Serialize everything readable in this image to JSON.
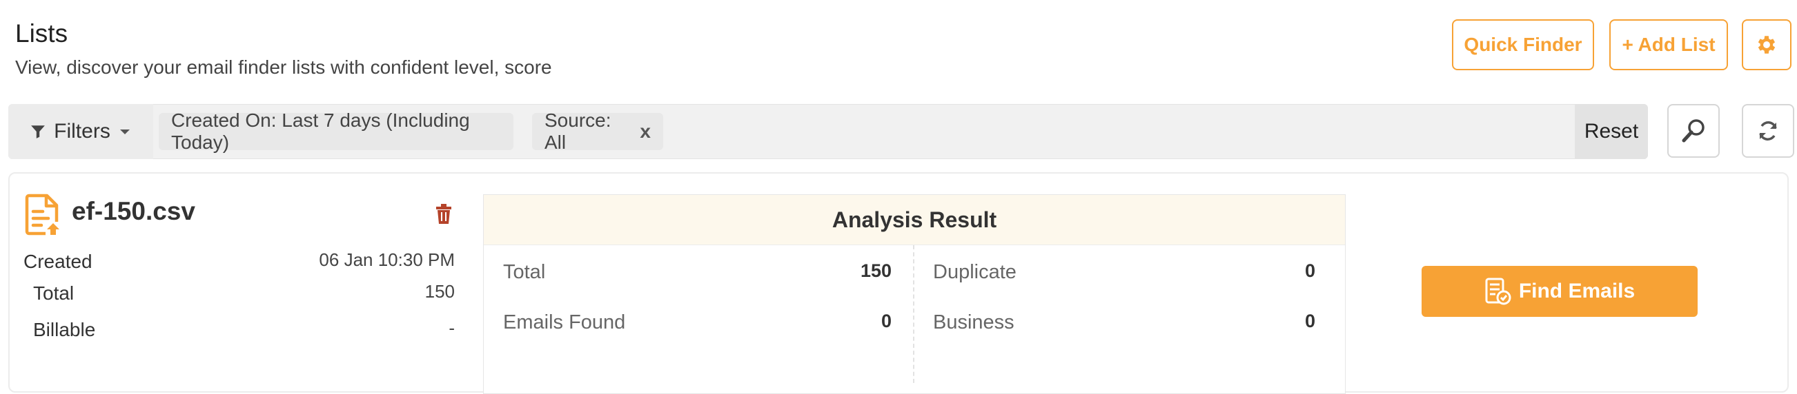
{
  "header": {
    "title": "Lists",
    "subtitle": "View, discover your email finder lists with confident level, score",
    "quick_finder_label": "Quick Finder",
    "add_list_label": "+ Add List",
    "settings_icon": "gear-icon"
  },
  "filter_bar": {
    "filters_label": "Filters",
    "chips": [
      {
        "label": "Created On: Last 7 days (Including Today)"
      },
      {
        "label": "Source: All",
        "remove": "x"
      }
    ],
    "reset_label": "Reset"
  },
  "list_card": {
    "file_name": "ef-150.csv",
    "created_label": "Created",
    "created_value": "06 Jan 10:30 PM",
    "total_label": "Total",
    "total_value": "150",
    "billable_label": "Billable",
    "billable_value": "-",
    "analysis": {
      "title": "Analysis Result",
      "total_label": "Total",
      "total_value": "150",
      "emails_found_label": "Emails Found",
      "emails_found_value": "0",
      "duplicate_label": "Duplicate",
      "duplicate_value": "0",
      "business_label": "Business",
      "business_value": "0"
    },
    "find_emails_label": "Find Emails"
  },
  "colors": {
    "accent": "#f7a235",
    "trash": "#b5432a",
    "analysis_header_bg": "#fdf8ec"
  }
}
